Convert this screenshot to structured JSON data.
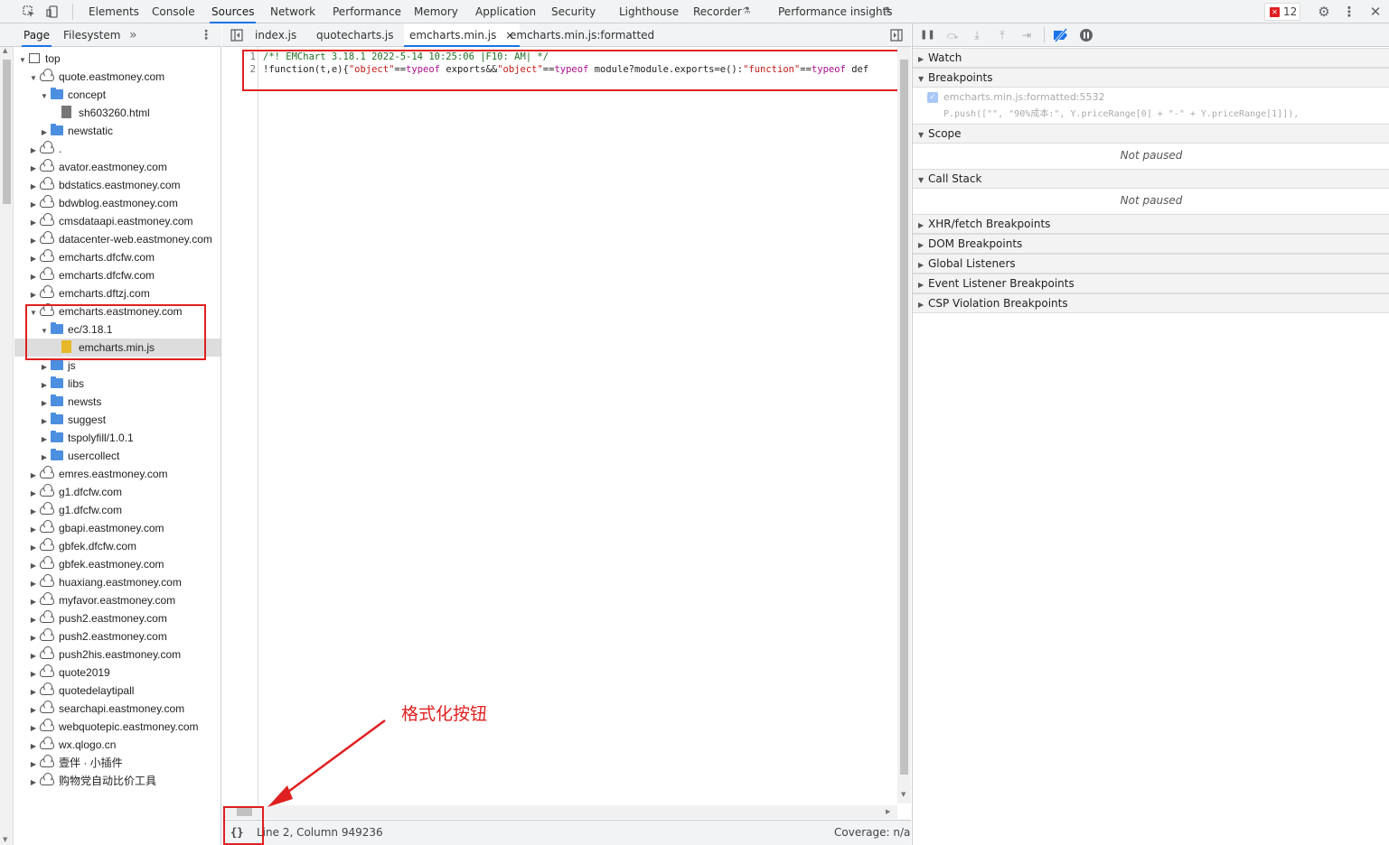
{
  "main_tabs": [
    "Elements",
    "Console",
    "Sources",
    "Network",
    "Performance",
    "Memory",
    "Application",
    "Security",
    "Lighthouse",
    "Recorder",
    "Performance insights"
  ],
  "active_tab": "Sources",
  "error_count": "12",
  "navigator": {
    "tabs": [
      "Page",
      "Filesystem"
    ],
    "more": "»",
    "tree": [
      {
        "label": "top",
        "kind": "frame",
        "indent": 0,
        "open": true
      },
      {
        "label": "quote.eastmoney.com",
        "kind": "cloud",
        "indent": 1,
        "open": true
      },
      {
        "label": "concept",
        "kind": "folder",
        "indent": 2,
        "open": true
      },
      {
        "label": "sh603260.html",
        "kind": "file",
        "indent": 3
      },
      {
        "label": "newstatic",
        "kind": "folder",
        "indent": 2,
        "open": false
      },
      {
        "label": ".",
        "kind": "cloud",
        "indent": 1,
        "open": false
      },
      {
        "label": "avator.eastmoney.com",
        "kind": "cloud",
        "indent": 1,
        "open": false
      },
      {
        "label": "bdstatics.eastmoney.com",
        "kind": "cloud",
        "indent": 1,
        "open": false
      },
      {
        "label": "bdwblog.eastmoney.com",
        "kind": "cloud",
        "indent": 1,
        "open": false
      },
      {
        "label": "cmsdataapi.eastmoney.com",
        "kind": "cloud",
        "indent": 1,
        "open": false
      },
      {
        "label": "datacenter-web.eastmoney.com",
        "kind": "cloud",
        "indent": 1,
        "open": false
      },
      {
        "label": "emcharts.dfcfw.com",
        "kind": "cloud",
        "indent": 1,
        "open": false
      },
      {
        "label": "emcharts.dfcfw.com",
        "kind": "cloud",
        "indent": 1,
        "open": false
      },
      {
        "label": "emcharts.dftzj.com",
        "kind": "cloud",
        "indent": 1,
        "open": false
      },
      {
        "label": "emcharts.eastmoney.com",
        "kind": "cloud",
        "indent": 1,
        "open": true
      },
      {
        "label": "ec/3.18.1",
        "kind": "folder",
        "indent": 2,
        "open": true
      },
      {
        "label": "emcharts.min.js",
        "kind": "jsfile",
        "indent": 3,
        "selected": true
      },
      {
        "label": "js",
        "kind": "folder",
        "indent": 2,
        "open": false
      },
      {
        "label": "libs",
        "kind": "folder",
        "indent": 2,
        "open": false
      },
      {
        "label": "newsts",
        "kind": "folder",
        "indent": 2,
        "open": false
      },
      {
        "label": "suggest",
        "kind": "folder",
        "indent": 2,
        "open": false
      },
      {
        "label": "tspolyfill/1.0.1",
        "kind": "folder",
        "indent": 2,
        "open": false
      },
      {
        "label": "usercollect",
        "kind": "folder",
        "indent": 2,
        "open": false
      },
      {
        "label": "emres.eastmoney.com",
        "kind": "cloud",
        "indent": 1,
        "open": false
      },
      {
        "label": "g1.dfcfw.com",
        "kind": "cloud",
        "indent": 1,
        "open": false
      },
      {
        "label": "g1.dfcfw.com",
        "kind": "cloud",
        "indent": 1,
        "open": false
      },
      {
        "label": "gbapi.eastmoney.com",
        "kind": "cloud",
        "indent": 1,
        "open": false
      },
      {
        "label": "gbfek.dfcfw.com",
        "kind": "cloud",
        "indent": 1,
        "open": false
      },
      {
        "label": "gbfek.eastmoney.com",
        "kind": "cloud",
        "indent": 1,
        "open": false
      },
      {
        "label": "huaxiang.eastmoney.com",
        "kind": "cloud",
        "indent": 1,
        "open": false
      },
      {
        "label": "myfavor.eastmoney.com",
        "kind": "cloud",
        "indent": 1,
        "open": false
      },
      {
        "label": "push2.eastmoney.com",
        "kind": "cloud",
        "indent": 1,
        "open": false
      },
      {
        "label": "push2.eastmoney.com",
        "kind": "cloud",
        "indent": 1,
        "open": false
      },
      {
        "label": "push2his.eastmoney.com",
        "kind": "cloud",
        "indent": 1,
        "open": false
      },
      {
        "label": "quote2019",
        "kind": "cloud",
        "indent": 1,
        "open": false
      },
      {
        "label": "quotedelaytipall",
        "kind": "cloud",
        "indent": 1,
        "open": false
      },
      {
        "label": "searchapi.eastmoney.com",
        "kind": "cloud",
        "indent": 1,
        "open": false
      },
      {
        "label": "webquotepic.eastmoney.com",
        "kind": "cloud",
        "indent": 1,
        "open": false
      },
      {
        "label": "wx.qlogo.cn",
        "kind": "cloud",
        "indent": 1,
        "open": false
      },
      {
        "label": "壹伴 · 小插件",
        "kind": "cloud",
        "indent": 1,
        "open": false
      },
      {
        "label": "购物党自动比价工具",
        "kind": "cloud",
        "indent": 1,
        "open": false
      }
    ]
  },
  "editor": {
    "tabs": [
      "index.js",
      "quotecharts.js",
      "emcharts.min.js",
      "emcharts.min.js:formatted"
    ],
    "active_tab": "emcharts.min.js",
    "close": "×",
    "lines": [
      {
        "num": "1",
        "segments": [
          {
            "t": "comment",
            "v": "/*! EMChart 3.18.1 2022-5-14 10:25:06 |F10: AM| */"
          }
        ]
      },
      {
        "num": "2",
        "segments": [
          {
            "t": "plain",
            "v": "!function(t,e){"
          },
          {
            "t": "str",
            "v": "\"object\""
          },
          {
            "t": "plain",
            "v": "=="
          },
          {
            "t": "kw",
            "v": "typeof"
          },
          {
            "t": "plain",
            "v": " exports&&"
          },
          {
            "t": "str",
            "v": "\"object\""
          },
          {
            "t": "plain",
            "v": "=="
          },
          {
            "t": "kw",
            "v": "typeof"
          },
          {
            "t": "plain",
            "v": " module?module.exports=e():"
          },
          {
            "t": "str",
            "v": "\"function\""
          },
          {
            "t": "plain",
            "v": "=="
          },
          {
            "t": "kw",
            "v": "typeof"
          },
          {
            "t": "plain",
            "v": " def"
          }
        ]
      }
    ],
    "status_position": "Line 2, Column 949236",
    "coverage": "Coverage: n/a",
    "format_button": "{}"
  },
  "debugger": {
    "sections": {
      "watch": "Watch",
      "breakpoints": "Breakpoints",
      "scope": "Scope",
      "call_stack": "Call Stack",
      "xhr": "XHR/fetch Breakpoints",
      "dom": "DOM Breakpoints",
      "global": "Global Listeners",
      "event": "Event Listener Breakpoints",
      "csp": "CSP Violation Breakpoints"
    },
    "breakpoint_file": "emcharts.min.js:formatted:5532",
    "breakpoint_code": "P.push([\"\", \"90%成本:\", Y.priceRange[0] + \"-\" + Y.priceRange[1]]),",
    "not_paused": "Not paused"
  },
  "annotation": "格式化按钮",
  "colors": {
    "accent": "#1a73e8",
    "highlight": "#e02020"
  }
}
